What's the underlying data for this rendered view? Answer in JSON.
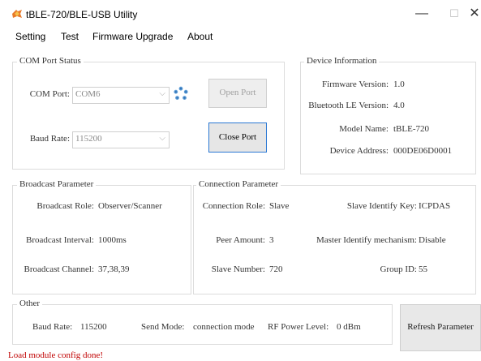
{
  "window": {
    "title": "tBLE-720/BLE-USB Utility",
    "minimize": "—",
    "maximize": "☐",
    "close": "✕"
  },
  "menu": [
    "Setting",
    "Test",
    "Firmware Upgrade",
    "About"
  ],
  "com_status": {
    "title": "COM Port Status",
    "com_port_label": "COM Port:",
    "com_port_value": "COM6",
    "baud_label": "Baud Rate:",
    "baud_value": "115200",
    "open_port": "Open Port",
    "close_port": "Close Port",
    "arrow": "⌵",
    "refresh_icon": "refresh-icon"
  },
  "device_info": {
    "title": "Device Information",
    "rows": [
      {
        "label": "Firmware Version:",
        "value": "1.0"
      },
      {
        "label": "Bluetooth LE Version:",
        "value": "4.0"
      },
      {
        "label": "Model Name:",
        "value": "tBLE-720"
      },
      {
        "label": "Device Address:",
        "value": "000DE06D0001"
      }
    ]
  },
  "broadcast": {
    "title": "Broadcast Parameter",
    "role_label": "Broadcast Role:",
    "role_value": "Observer/Scanner",
    "interval_label": "Broadcast Interval:",
    "interval_value": "1000ms",
    "channel_label": "Broadcast Channel:",
    "channel_value": "37,38,39"
  },
  "connection": {
    "title": "Connection Parameter",
    "role_label": "Connection Role:",
    "role_value": "Slave",
    "peer_label": "Peer Amount:",
    "peer_value": "3",
    "slave_label": "Slave Number:",
    "slave_value": "720",
    "key_label": "Slave Identify Key:",
    "key_value": "ICPDAS",
    "mech_label": "Master Identify mechanism:",
    "mech_value": "Disable",
    "group_label": "Group ID:",
    "group_value": "55"
  },
  "other": {
    "title": "Other",
    "baud_label": "Baud Rate:",
    "baud_value": "115200",
    "mode_label": "Send Mode:",
    "mode_value": "connection mode",
    "rf_label": "RF Power Level:",
    "rf_value": "0 dBm",
    "refresh": "Refresh Parameter"
  },
  "status": "Load module config done!"
}
